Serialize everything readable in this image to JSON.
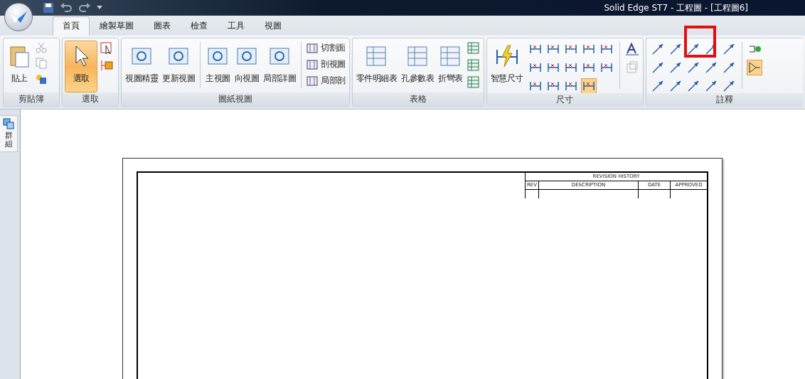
{
  "window": {
    "title": "Solid Edge ST7 - 工程圖 - [工程圖6]"
  },
  "tabs": [
    {
      "label": "首頁",
      "selected": true
    },
    {
      "label": "繪製草圖",
      "selected": false
    },
    {
      "label": "圖表",
      "selected": false
    },
    {
      "label": "檢查",
      "selected": false
    },
    {
      "label": "工具",
      "selected": false
    },
    {
      "label": "視圖",
      "selected": false
    }
  ],
  "ribbon": {
    "groups": [
      {
        "kind": "clipboard",
        "label": "剪貼簿",
        "items": [
          {
            "kind": "large",
            "label": "貼上",
            "active": false
          }
        ]
      },
      {
        "kind": "select",
        "label": "選取",
        "items": [
          {
            "kind": "large",
            "label": "選取",
            "active": true
          }
        ]
      },
      {
        "kind": "views",
        "label": "圖紙視圖",
        "items": [
          {
            "kind": "large",
            "label": "視圖精靈",
            "active": false
          },
          {
            "kind": "large",
            "label": "更新視圖",
            "active": false
          },
          {
            "kind": "separator"
          },
          {
            "kind": "large",
            "label": "主視圖",
            "active": false
          },
          {
            "kind": "large",
            "label": "向視圖",
            "active": false
          },
          {
            "kind": "large",
            "label": "局部詳圖",
            "active": false
          },
          {
            "kind": "separator"
          },
          {
            "kind": "small",
            "label": "切割面"
          },
          {
            "kind": "small",
            "label": "剖視圖"
          },
          {
            "kind": "small",
            "label": "局部剖"
          }
        ]
      },
      {
        "kind": "tables",
        "label": "表格",
        "items": [
          {
            "kind": "large",
            "label": "零件明細表",
            "active": false
          },
          {
            "kind": "large",
            "label": "孔參數表",
            "active": false
          },
          {
            "kind": "large",
            "label": "折彎表",
            "active": false
          }
        ]
      },
      {
        "kind": "dimensions",
        "label": "尺寸",
        "items": [
          {
            "kind": "large",
            "label": "智慧尺寸",
            "active": false
          }
        ]
      },
      {
        "kind": "annotations",
        "label": "註釋"
      }
    ]
  },
  "side_panel": {
    "tab": {
      "label": "群組"
    }
  },
  "drawing": {
    "revision_table": {
      "title": "REVISION HISTORY",
      "columns": [
        "REV",
        "DESCRIPTION",
        "DATE",
        "APPROVED"
      ]
    }
  }
}
